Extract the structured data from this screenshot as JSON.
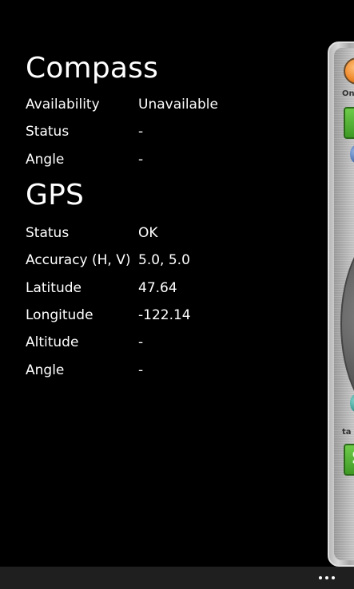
{
  "compass": {
    "title": "Compass",
    "rows": [
      {
        "label": "Availability",
        "value": "Unavailable"
      },
      {
        "label": "Status",
        "value": "-"
      },
      {
        "label": "Angle",
        "value": "-"
      }
    ]
  },
  "gps": {
    "title": "GPS",
    "rows": [
      {
        "label": "Status",
        "value": "OK"
      },
      {
        "label": "Accuracy (H, V)",
        "value": "5.0, 5.0"
      },
      {
        "label": "Latitude",
        "value": "47.64"
      },
      {
        "label": "Longitude",
        "value": "-122.14"
      },
      {
        "label": "Altitude",
        "value": "-"
      },
      {
        "label": "Angle",
        "value": "-"
      }
    ]
  },
  "side_panel": {
    "top_text": "On",
    "bottom_text": "ta",
    "bottom_button_glyph": "S"
  },
  "app_bar": {
    "more_icon": "ellipsis-icon",
    "background": "#1f1f1f"
  },
  "colors": {
    "background": "#000000",
    "text": "#ffffff",
    "panel_knob": "#f08a2a",
    "panel_button": "#3f9a25"
  }
}
